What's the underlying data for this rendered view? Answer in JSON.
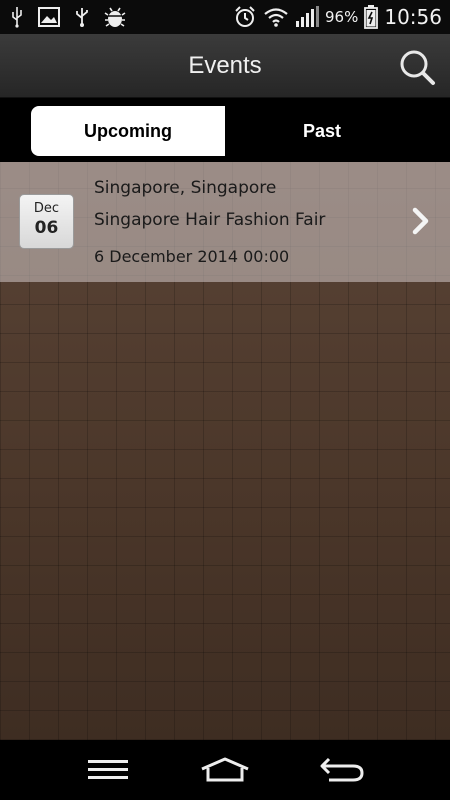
{
  "status_bar": {
    "battery_text": "96%",
    "time": "10:56",
    "icons": [
      "usb-icon",
      "image-icon",
      "usb-trident-icon",
      "android-debug-icon",
      "alarm-icon",
      "wifi-icon",
      "signal-icon",
      "battery-charging-icon"
    ]
  },
  "header": {
    "title": "Events",
    "search_icon": "search-icon"
  },
  "tabs": {
    "upcoming": "Upcoming",
    "past": "Past",
    "selected": "Upcoming"
  },
  "events": [
    {
      "month": "Dec",
      "day": "06",
      "location": "Singapore, Singapore",
      "name": "Singapore Hair Fashion Fair",
      "datetime": "6 December 2014 00:00"
    }
  ],
  "nav_bar": {
    "icons": [
      "menu-icon",
      "home-icon",
      "back-icon"
    ]
  },
  "colors": {
    "header_bg": "#2e2e2e",
    "tab_selected_bg": "#ffffff",
    "content_bg": "#4b372b",
    "row_bg": "#c8bebe"
  }
}
